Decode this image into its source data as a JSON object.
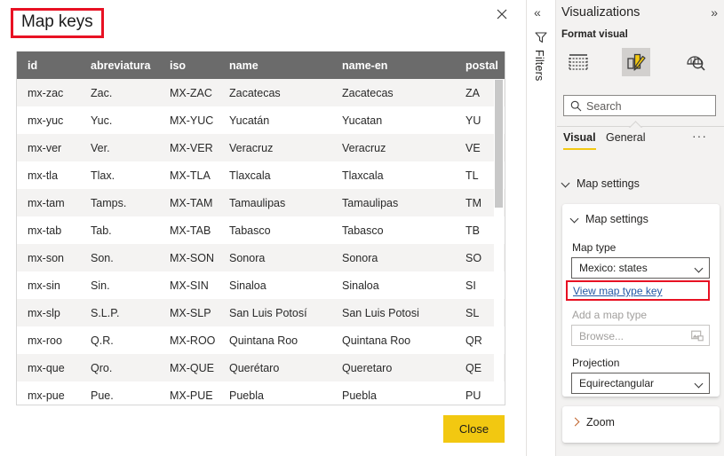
{
  "dialog": {
    "title": "Map keys",
    "close_icon": "close-x-icon",
    "close_button_label": "Close",
    "table": {
      "columns": [
        "id",
        "abreviatura",
        "iso",
        "name",
        "name-en",
        "postal"
      ],
      "rows": [
        [
          "mx-zac",
          "Zac.",
          "MX-ZAC",
          "Zacatecas",
          "Zacatecas",
          "ZA"
        ],
        [
          "mx-yuc",
          "Yuc.",
          "MX-YUC",
          "Yucatán",
          "Yucatan",
          "YU"
        ],
        [
          "mx-ver",
          "Ver.",
          "MX-VER",
          "Veracruz",
          "Veracruz",
          "VE"
        ],
        [
          "mx-tla",
          "Tlax.",
          "MX-TLA",
          "Tlaxcala",
          "Tlaxcala",
          "TL"
        ],
        [
          "mx-tam",
          "Tamps.",
          "MX-TAM",
          "Tamaulipas",
          "Tamaulipas",
          "TM"
        ],
        [
          "mx-tab",
          "Tab.",
          "MX-TAB",
          "Tabasco",
          "Tabasco",
          "TB"
        ],
        [
          "mx-son",
          "Son.",
          "MX-SON",
          "Sonora",
          "Sonora",
          "SO"
        ],
        [
          "mx-sin",
          "Sin.",
          "MX-SIN",
          "Sinaloa",
          "Sinaloa",
          "SI"
        ],
        [
          "mx-slp",
          "S.L.P.",
          "MX-SLP",
          "San Luis Potosí",
          "San Luis Potosi",
          "SL"
        ],
        [
          "mx-roo",
          "Q.R.",
          "MX-ROO",
          "Quintana Roo",
          "Quintana Roo",
          "QR"
        ],
        [
          "mx-que",
          "Qro.",
          "MX-QUE",
          "Querétaro",
          "Queretaro",
          "QE"
        ],
        [
          "mx-pue",
          "Pue.",
          "MX-PUE",
          "Puebla",
          "Puebla",
          "PU"
        ]
      ]
    }
  },
  "rail": {
    "collapse_icon": "double-chevron-left-icon",
    "filter_icon": "filter-funnel-icon",
    "label": "Filters"
  },
  "panel": {
    "title": "Visualizations",
    "expand_icon": "double-chevron-right-icon",
    "format_visual_label": "Format visual",
    "icons": [
      {
        "name": "build-visual-icon",
        "selected": false
      },
      {
        "name": "format-visual-icon",
        "selected": true
      },
      {
        "name": "analytics-icon",
        "selected": false
      }
    ],
    "search": {
      "icon": "search-icon",
      "placeholder": "Search",
      "value": ""
    },
    "tabs": [
      {
        "label": "Visual",
        "active": true
      },
      {
        "label": "General",
        "active": false
      }
    ],
    "more_label": "···",
    "sections": {
      "map_settings_outer": "Map settings",
      "map_settings_inner": "Map settings",
      "zoom": "Zoom"
    },
    "fields": {
      "map_type_label": "Map type",
      "map_type_value": "Mexico: states",
      "view_map_type_key": "View map type key",
      "add_map_type_label": "Add a map type",
      "browse_placeholder": "Browse...",
      "browse_icon": "image-picker-icon",
      "projection_label": "Projection",
      "projection_value": "Equirectangular"
    }
  },
  "colors": {
    "accent_yellow": "#f2c811",
    "highlight_red": "#e81123",
    "header_gray": "#6b6b6b",
    "panel_bg": "#f3f2f1",
    "link_blue": "#2357a4"
  }
}
